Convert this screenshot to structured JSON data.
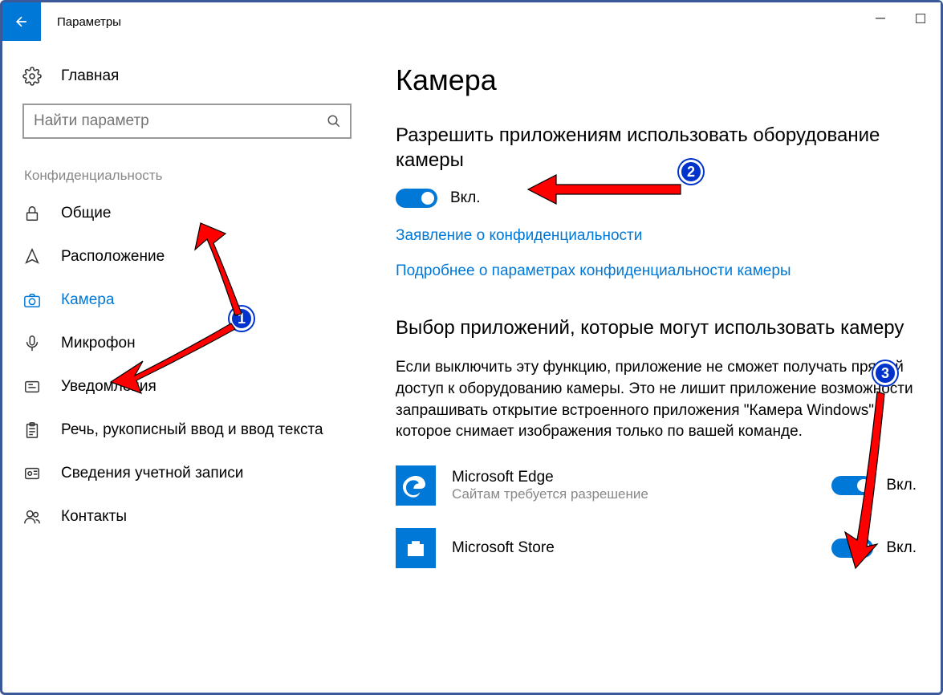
{
  "titlebar": {
    "title": "Параметры"
  },
  "sidebar": {
    "home": "Главная",
    "search_placeholder": "Найти параметр",
    "category": "Конфиденциальность",
    "items": [
      {
        "label": "Общие"
      },
      {
        "label": "Расположение"
      },
      {
        "label": "Камера",
        "active": true
      },
      {
        "label": "Микрофон"
      },
      {
        "label": "Уведомления"
      },
      {
        "label": "Речь, рукописный ввод и ввод текста"
      },
      {
        "label": "Сведения учетной записи"
      },
      {
        "label": "Контакты"
      }
    ]
  },
  "main": {
    "heading": "Камера",
    "allow_heading": "Разрешить приложениям использовать оборудование камеры",
    "allow_toggle_label": "Вкл.",
    "link_privacy": "Заявление о конфиденциальности",
    "link_more": "Подробнее о параметрах конфиденциальности камеры",
    "choose_heading": "Выбор приложений, которые могут использовать камеру",
    "description": "Если выключить эту функцию, приложение не сможет получать прямой доступ к оборудованию камеры. Это не лишит приложение возможности запрашивать открытие встроенного приложения \"Камера Windows\", которое снимает изображения только по вашей команде.",
    "apps": [
      {
        "name": "Microsoft Edge",
        "sub": "Сайтам требуется разрешение",
        "toggle": "Вкл."
      },
      {
        "name": "Microsoft Store",
        "sub": "",
        "toggle": "Вкл."
      }
    ]
  },
  "callouts": {
    "c1": "1",
    "c2": "2",
    "c3": "3"
  }
}
